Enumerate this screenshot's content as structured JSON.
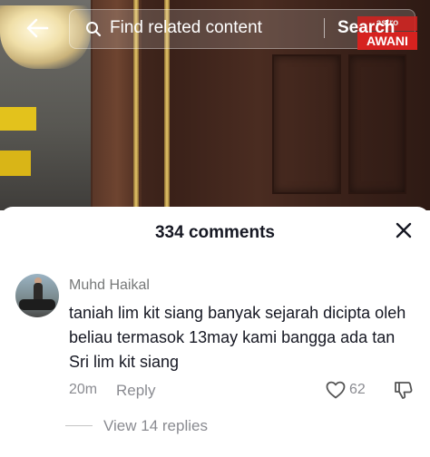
{
  "top_bar": {
    "search_placeholder": "Find related content",
    "search_button": "Search",
    "logo_top": "astro",
    "logo_bottom": "AWANI"
  },
  "comments_panel": {
    "count_label": "334 comments",
    "comment": {
      "username": "Muhd Haikal",
      "text": "taniah lim kit siang banyak sejarah dicipta oleh beliau termasok 13may kami bangga ada tan Sri lim kit siang",
      "time": "20m",
      "reply_label": "Reply",
      "like_count": "62",
      "view_replies": "View 14 replies"
    }
  }
}
